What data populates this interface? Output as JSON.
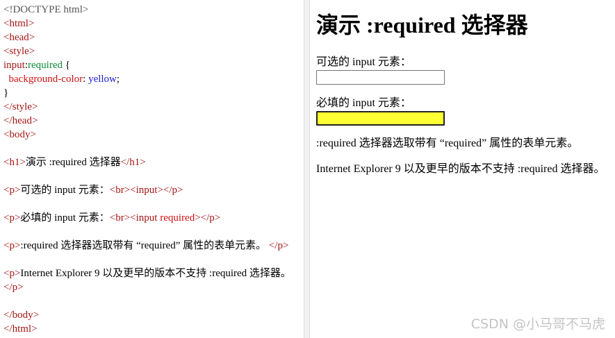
{
  "editor": {
    "lines": [
      [
        {
          "c": "t-doctype",
          "t": "<!DOCTYPE html>"
        }
      ],
      [
        {
          "c": "t-tag",
          "t": "<html>"
        }
      ],
      [
        {
          "c": "t-tag",
          "t": "<head>"
        }
      ],
      [
        {
          "c": "t-tag",
          "t": "<style>"
        }
      ],
      [
        {
          "c": "t-sel",
          "t": "input"
        },
        {
          "c": "t-text",
          "t": ":"
        },
        {
          "c": "t-pseudo",
          "t": "required"
        },
        {
          "c": "t-text",
          "t": " {"
        }
      ],
      [
        {
          "c": "t-text",
          "t": "  "
        },
        {
          "c": "t-prop",
          "t": "background-color"
        },
        {
          "c": "t-text",
          "t": ": "
        },
        {
          "c": "t-val",
          "t": "yellow"
        },
        {
          "c": "t-text",
          "t": ";"
        }
      ],
      [
        {
          "c": "t-text",
          "t": "}"
        }
      ],
      [
        {
          "c": "t-tag",
          "t": "</style>"
        }
      ],
      [
        {
          "c": "t-tag",
          "t": "</head>"
        }
      ],
      [
        {
          "c": "t-tag",
          "t": "<body>"
        }
      ],
      [],
      [
        {
          "c": "t-tag",
          "t": "<h1>"
        },
        {
          "c": "t-text",
          "t": "演示 :required 选择器"
        },
        {
          "c": "t-tag",
          "t": "</h1>"
        }
      ],
      [],
      [
        {
          "c": "t-tag",
          "t": "<p>"
        },
        {
          "c": "t-text",
          "t": "可选的 input 元素："
        },
        {
          "c": "t-tag",
          "t": "<br><input></p>"
        }
      ],
      [],
      [
        {
          "c": "t-tag",
          "t": "<p>"
        },
        {
          "c": "t-text",
          "t": "必填的 input 元素："
        },
        {
          "c": "t-tag",
          "t": "<br><input "
        },
        {
          "c": "t-attr",
          "t": "required"
        },
        {
          "c": "t-tag",
          "t": "></p>"
        }
      ],
      [],
      [
        {
          "c": "t-tag",
          "t": "<p>"
        },
        {
          "c": "t-text",
          "t": ":required 选择器选取带有 “required” 属性的表单元素。 "
        },
        {
          "c": "t-tag",
          "t": "</p>"
        }
      ],
      [],
      [
        {
          "c": "t-tag",
          "t": "<p>"
        },
        {
          "c": "t-text",
          "t": "Internet Explorer 9 以及更早的版本不支持 :required 选择器。"
        }
      ],
      [
        {
          "c": "t-tag",
          "t": "</p>"
        }
      ],
      [],
      [
        {
          "c": "t-tag",
          "t": "</body>"
        }
      ],
      [
        {
          "c": "t-tag",
          "t": "</html>"
        }
      ]
    ]
  },
  "preview": {
    "heading": "演示 :required 选择器",
    "optional_label": "可选的 input 元素：",
    "optional_value": "",
    "required_label": "必填的 input 元素：",
    "required_value": "",
    "required_bg_color": "#ffff33",
    "para1": ":required 选择器选取带有 “required” 属性的表单元素。",
    "para2": "Internet Explorer 9 以及更早的版本不支持 :required 选择器。"
  },
  "watermark": "CSDN @小马哥不马虎"
}
